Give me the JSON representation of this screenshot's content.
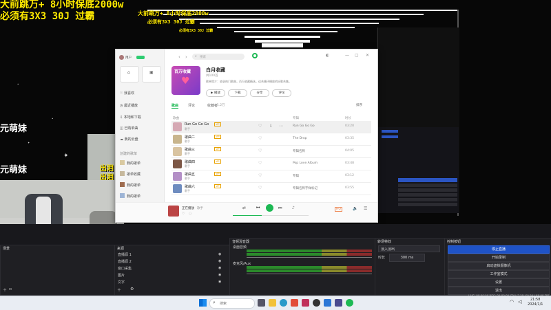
{
  "overlay": {
    "line1": "大前跳万+ 8小时保底2000w",
    "line2": "必须有3X3 30J 过霸",
    "line2b": "必须有3X3 30J 过霸",
    "echo1": "大前跳万+ 8小时保底2000w",
    "echo2": "必须有3X3 30J 过霸",
    "side_text_1": "元萌妹",
    "side_text_2": "元萌妹",
    "side_text_3": "出泪",
    "side_text_4": "出泪"
  },
  "music": {
    "search_placeholder": "搜索",
    "user_name": "用户",
    "sidebar": [
      {
        "label": "我喜欢",
        "icon": "heart-icon"
      },
      {
        "label": "最近播放",
        "icon": "clock-icon"
      },
      {
        "label": "本地和下载",
        "icon": "download-icon"
      },
      {
        "label": "已购单曲",
        "icon": "bag-icon"
      },
      {
        "label": "我的云盘",
        "icon": "cloud-icon"
      }
    ],
    "playlist_section": "创建的歌单",
    "playlists": [
      "我的歌单",
      "歌单收藏",
      "我的歌单",
      "我的歌单"
    ],
    "playlist_cover_text": "百万收藏",
    "playlist_title": "白月收藏",
    "playlist_meta": "共100首",
    "playlist_desc": "歌单简介：收录热门歌曲，百万收藏精选，适合循环播放的好歌合集。",
    "actions": [
      "播放",
      "下载",
      "分享",
      "评论"
    ],
    "tabs": [
      "歌曲",
      "评论",
      "收藏者"
    ],
    "tab_count": "1.2万",
    "sort_label": "排序",
    "col_headers": [
      "歌曲",
      "专辑",
      "时长"
    ],
    "songs": [
      {
        "title": "Run Go Go Go",
        "artist": "歌手",
        "album": "Run Go Go Go",
        "duration": "03:20",
        "tags": [
          "VIP"
        ]
      },
      {
        "title": "歌曲二",
        "artist": "歌手",
        "album": "The Drop",
        "duration": "03:35",
        "tags": [
          "VIP"
        ]
      },
      {
        "title": "歌曲三",
        "artist": "歌手",
        "album": "专辑名称",
        "duration": "04:05",
        "tags": [
          "VIP"
        ]
      },
      {
        "title": "歌曲四",
        "artist": "歌手",
        "album": "Pop Love Album",
        "duration": "03:48",
        "tags": [
          "VIP"
        ]
      },
      {
        "title": "歌曲五",
        "artist": "歌手",
        "album": "专辑",
        "duration": "03:12",
        "tags": [
          "VIP"
        ]
      },
      {
        "title": "歌曲六",
        "artist": "歌手",
        "album": "专辑名称字样标记",
        "duration": "03:55",
        "tags": [
          "VIP"
        ]
      }
    ],
    "now_playing_title": "正在播放",
    "now_playing_artist": "歌手",
    "progress": 0.38
  },
  "obs": {
    "scenes_title": "场景",
    "scenes": [
      "场景",
      "场景 2",
      "场景 3"
    ],
    "sources_title": "来源",
    "sources": [
      "直播源 1",
      "直播源 2",
      "窗口采集",
      "图片",
      "文字"
    ],
    "mixer_title": "音频混音器",
    "mixer_tracks": [
      {
        "name": "桌面音频",
        "level": 0.72
      },
      {
        "name": "麦克风/Aux",
        "level": 0.55
      }
    ],
    "transitions_title": "转场特效",
    "transition_value": "淡入淡出",
    "duration_label": "时长",
    "duration_value": "300 ms",
    "controls_title": "控制按钮",
    "controls": [
      "停止直播",
      "开始录制",
      "启动虚拟摄像机",
      "工作室模式",
      "设置",
      "退出"
    ],
    "status": "LIVE: 00:00:00  REC: 00:00:00  CPU: 2.1%  60.00 / 60.00 FPS"
  },
  "taskbar": {
    "search_placeholder": "搜索",
    "time": "21:58",
    "date": "2024/1/1"
  },
  "colors": {
    "accent": "#1db954",
    "obs_blue": "#1f53c7",
    "overlay_yellow": "#ffea00"
  }
}
